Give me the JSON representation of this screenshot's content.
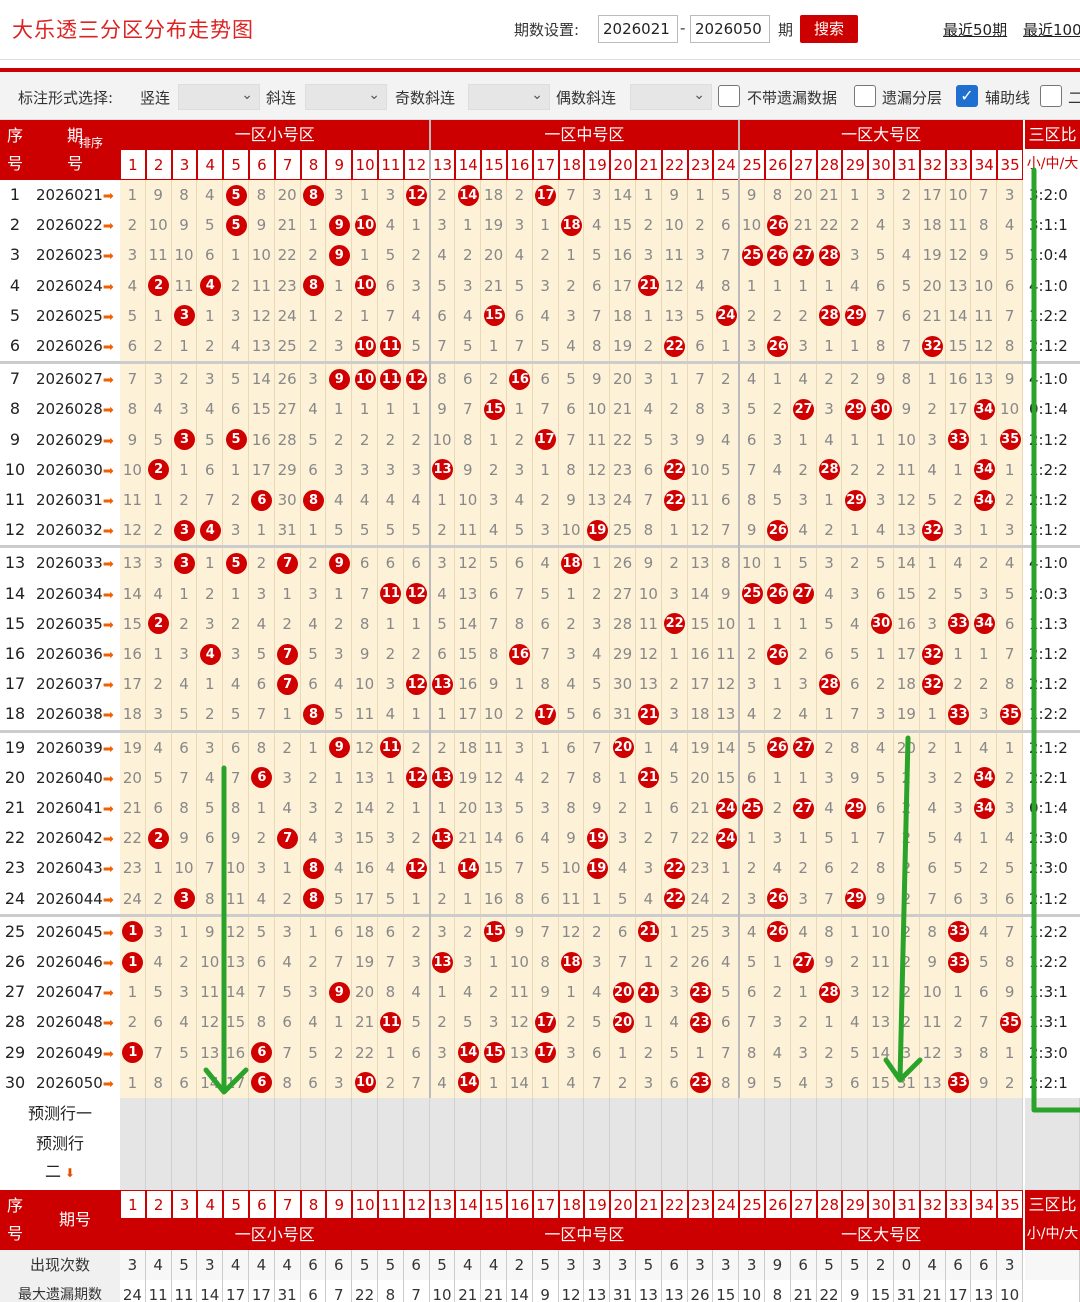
{
  "title": "大乐透三分区分布走势图",
  "period": {
    "label": "期数设置:",
    "start": "2026021",
    "dash": "-",
    "end": "2026050",
    "unit": "期",
    "search": "搜索"
  },
  "links": {
    "recent50": "最近50期",
    "recent100": "最近100"
  },
  "filter": {
    "mark_label": "标注形式选择:",
    "vertical": "竖连",
    "diag": "斜连",
    "odd_diag": "奇数斜连",
    "even_diag": "偶数斜连",
    "no_miss": "不带遗漏数据",
    "miss_layer": "遗漏分层",
    "aux_line": "辅助线",
    "more": "二",
    "checked_aux": true
  },
  "colors": {
    "accent": "#c00000",
    "cell_bg": "#fdf1d8",
    "ball": "#d00000",
    "annotation": "#2aa32a"
  },
  "header": {
    "seq": "序号",
    "issue": "期号",
    "sort": "排序",
    "zone1": "一区小号区",
    "zone2": "一区中号区",
    "zone3": "一区大号区",
    "ratio": "三区比",
    "ratio_sub": "小/中/大",
    "numbers": [
      1,
      2,
      3,
      4,
      5,
      6,
      7,
      8,
      9,
      10,
      11,
      12,
      13,
      14,
      15,
      16,
      17,
      18,
      19,
      20,
      21,
      22,
      23,
      24,
      25,
      26,
      27,
      28,
      29,
      30,
      31,
      32,
      33,
      34,
      35
    ]
  },
  "rows": [
    {
      "seq": 1,
      "issue": "2026021",
      "cells": [
        1,
        9,
        8,
        4,
        "5",
        8,
        20,
        "8",
        3,
        1,
        3,
        "12",
        2,
        "14",
        18,
        2,
        "17",
        7,
        3,
        14,
        1,
        9,
        1,
        5,
        9,
        8,
        20,
        21,
        1,
        3,
        2,
        17,
        10,
        7,
        3
      ],
      "ratio": "3:2:0"
    },
    {
      "seq": 2,
      "issue": "2026022",
      "cells": [
        2,
        10,
        9,
        5,
        "5",
        9,
        21,
        1,
        "9",
        "10",
        4,
        1,
        3,
        1,
        19,
        3,
        1,
        "18",
        4,
        15,
        2,
        10,
        2,
        6,
        10,
        "26",
        21,
        22,
        2,
        4,
        3,
        18,
        11,
        8,
        4
      ],
      "ratio": "3:1:1"
    },
    {
      "seq": 3,
      "issue": "2026023",
      "cells": [
        3,
        11,
        10,
        6,
        1,
        10,
        22,
        2,
        "9",
        1,
        5,
        2,
        4,
        2,
        20,
        4,
        2,
        1,
        5,
        16,
        3,
        11,
        3,
        7,
        "25",
        "26",
        "27",
        "28",
        3,
        5,
        4,
        19,
        12,
        9,
        5
      ],
      "ratio": "1:0:4"
    },
    {
      "seq": 4,
      "issue": "2026024",
      "cells": [
        4,
        "2",
        11,
        "4",
        2,
        11,
        23,
        "8",
        1,
        "10",
        6,
        3,
        5,
        3,
        21,
        5,
        3,
        2,
        6,
        17,
        "21",
        12,
        4,
        8,
        1,
        1,
        1,
        1,
        4,
        6,
        5,
        20,
        13,
        10,
        6
      ],
      "ratio": "4:1:0"
    },
    {
      "seq": 5,
      "issue": "2026025",
      "cells": [
        5,
        1,
        "3",
        1,
        3,
        12,
        24,
        1,
        2,
        1,
        7,
        4,
        6,
        4,
        "15",
        6,
        4,
        3,
        7,
        18,
        1,
        13,
        5,
        "24",
        2,
        2,
        2,
        "28",
        "29",
        7,
        6,
        21,
        14,
        11,
        7
      ],
      "ratio": "1:2:2"
    },
    {
      "seq": 6,
      "issue": "2026026",
      "cells": [
        6,
        2,
        1,
        2,
        4,
        13,
        25,
        2,
        3,
        "10",
        "11",
        5,
        7,
        5,
        1,
        7,
        5,
        4,
        8,
        19,
        2,
        "22",
        6,
        1,
        3,
        "26",
        3,
        1,
        1,
        8,
        7,
        "32",
        15,
        12,
        8
      ],
      "ratio": "2:1:2"
    },
    {
      "seq": 7,
      "issue": "2026027",
      "cells": [
        7,
        3,
        2,
        3,
        5,
        14,
        26,
        3,
        "9",
        "10",
        "11",
        "12",
        8,
        6,
        2,
        "16",
        6,
        5,
        9,
        20,
        3,
        1,
        7,
        2,
        4,
        1,
        4,
        2,
        2,
        9,
        8,
        1,
        16,
        13,
        9
      ],
      "ratio": "4:1:0"
    },
    {
      "seq": 8,
      "issue": "2026028",
      "cells": [
        8,
        4,
        3,
        4,
        6,
        15,
        27,
        4,
        1,
        1,
        1,
        1,
        9,
        7,
        "15",
        1,
        7,
        6,
        10,
        21,
        4,
        2,
        8,
        3,
        5,
        2,
        "27",
        3,
        "29",
        "30",
        9,
        2,
        17,
        "34",
        10
      ],
      "ratio": "0:1:4"
    },
    {
      "seq": 9,
      "issue": "2026029",
      "cells": [
        9,
        5,
        "3",
        5,
        "5",
        16,
        28,
        5,
        2,
        2,
        2,
        2,
        10,
        8,
        1,
        2,
        "17",
        7,
        11,
        22,
        5,
        3,
        9,
        4,
        6,
        3,
        1,
        4,
        1,
        1,
        10,
        3,
        "33",
        1,
        "35"
      ],
      "ratio": "2:1:2"
    },
    {
      "seq": 10,
      "issue": "2026030",
      "cells": [
        10,
        "2",
        1,
        6,
        1,
        17,
        29,
        6,
        3,
        3,
        3,
        3,
        "13",
        9,
        2,
        3,
        1,
        8,
        12,
        23,
        6,
        "22",
        10,
        5,
        7,
        4,
        2,
        "28",
        2,
        2,
        11,
        4,
        1,
        "34",
        1
      ],
      "ratio": "1:2:2"
    },
    {
      "seq": 11,
      "issue": "2026031",
      "cells": [
        11,
        1,
        2,
        7,
        2,
        "6",
        30,
        "8",
        4,
        4,
        4,
        4,
        1,
        10,
        3,
        4,
        2,
        9,
        13,
        24,
        7,
        "22",
        11,
        6,
        8,
        5,
        3,
        1,
        "29",
        3,
        12,
        5,
        2,
        "34",
        2
      ],
      "ratio": "2:1:2"
    },
    {
      "seq": 12,
      "issue": "2026032",
      "cells": [
        12,
        2,
        "3",
        "4",
        3,
        1,
        31,
        1,
        5,
        5,
        5,
        5,
        2,
        11,
        4,
        5,
        3,
        10,
        "19",
        25,
        8,
        1,
        12,
        7,
        9,
        "26",
        4,
        2,
        1,
        4,
        13,
        "32",
        3,
        1,
        3
      ],
      "ratio": "2:1:2"
    },
    {
      "seq": 13,
      "issue": "2026033",
      "cells": [
        13,
        3,
        "3",
        1,
        "5",
        2,
        "7",
        2,
        "9",
        6,
        6,
        6,
        3,
        12,
        5,
        6,
        4,
        "18",
        1,
        26,
        9,
        2,
        13,
        8,
        10,
        1,
        5,
        3,
        2,
        5,
        14,
        1,
        4,
        2,
        4
      ],
      "ratio": "4:1:0"
    },
    {
      "seq": 14,
      "issue": "2026034",
      "cells": [
        14,
        4,
        1,
        2,
        1,
        3,
        1,
        3,
        1,
        7,
        "11",
        "12",
        4,
        13,
        6,
        7,
        5,
        1,
        2,
        27,
        10,
        3,
        14,
        9,
        "25",
        "26",
        "27",
        4,
        3,
        6,
        15,
        2,
        5,
        3,
        5
      ],
      "ratio": "2:0:3"
    },
    {
      "seq": 15,
      "issue": "2026035",
      "cells": [
        15,
        "2",
        2,
        3,
        2,
        4,
        2,
        4,
        2,
        8,
        1,
        1,
        5,
        14,
        7,
        8,
        6,
        2,
        3,
        28,
        11,
        "22",
        15,
        10,
        1,
        1,
        1,
        5,
        4,
        "30",
        16,
        3,
        "33",
        "34",
        6
      ],
      "ratio": "1:1:3"
    },
    {
      "seq": 16,
      "issue": "2026036",
      "cells": [
        16,
        1,
        3,
        "4",
        3,
        5,
        "7",
        5,
        3,
        9,
        2,
        2,
        6,
        15,
        8,
        "16",
        7,
        3,
        4,
        29,
        12,
        1,
        16,
        11,
        2,
        "26",
        2,
        6,
        5,
        1,
        17,
        "32",
        1,
        1,
        7
      ],
      "ratio": "2:1:2"
    },
    {
      "seq": 17,
      "issue": "2026037",
      "cells": [
        17,
        2,
        4,
        1,
        4,
        6,
        "7",
        6,
        4,
        10,
        3,
        "12",
        "13",
        16,
        9,
        1,
        8,
        4,
        5,
        30,
        13,
        2,
        17,
        12,
        3,
        1,
        3,
        "28",
        6,
        2,
        18,
        "32",
        2,
        2,
        8
      ],
      "ratio": "2:1:2"
    },
    {
      "seq": 18,
      "issue": "2026038",
      "cells": [
        18,
        3,
        5,
        2,
        5,
        7,
        1,
        "8",
        5,
        11,
        4,
        1,
        1,
        17,
        10,
        2,
        "17",
        5,
        6,
        31,
        "21",
        3,
        18,
        13,
        4,
        2,
        4,
        1,
        7,
        3,
        19,
        1,
        "33",
        3,
        "35"
      ],
      "ratio": "1:2:2"
    },
    {
      "seq": 19,
      "issue": "2026039",
      "cells": [
        19,
        4,
        6,
        3,
        6,
        8,
        2,
        1,
        "9",
        12,
        "11",
        2,
        2,
        18,
        11,
        3,
        1,
        6,
        7,
        "20",
        1,
        4,
        19,
        14,
        5,
        "26",
        "27",
        2,
        8,
        4,
        20,
        2,
        1,
        4,
        1
      ],
      "ratio": "2:1:2"
    },
    {
      "seq": 20,
      "issue": "2026040",
      "cells": [
        20,
        5,
        7,
        4,
        7,
        "6",
        3,
        2,
        1,
        13,
        1,
        "12",
        "13",
        19,
        12,
        4,
        2,
        7,
        8,
        1,
        "21",
        5,
        20,
        15,
        6,
        1,
        1,
        3,
        9,
        5,
        2,
        3,
        2,
        "34",
        2
      ],
      "ratio": "2:2:1"
    },
    {
      "seq": 21,
      "issue": "2026041",
      "cells": [
        21,
        6,
        8,
        5,
        8,
        1,
        4,
        3,
        2,
        14,
        2,
        1,
        1,
        20,
        13,
        5,
        3,
        8,
        9,
        2,
        1,
        6,
        21,
        "24",
        "25",
        2,
        "27",
        4,
        "29",
        6,
        2,
        4,
        3,
        "34",
        3
      ],
      "ratio": "0:1:4"
    },
    {
      "seq": 22,
      "issue": "2026042",
      "cells": [
        22,
        "2",
        9,
        6,
        9,
        2,
        "7",
        4,
        3,
        15,
        3,
        2,
        "13",
        21,
        14,
        6,
        4,
        9,
        "19",
        3,
        2,
        7,
        22,
        "24",
        1,
        3,
        1,
        5,
        1,
        7,
        2,
        5,
        4,
        1,
        4
      ],
      "ratio": "2:3:0"
    },
    {
      "seq": 23,
      "issue": "2026043",
      "cells": [
        23,
        1,
        10,
        7,
        10,
        3,
        1,
        "8",
        4,
        16,
        4,
        "12",
        1,
        "14",
        15,
        7,
        5,
        10,
        "19",
        4,
        3,
        "22",
        23,
        1,
        2,
        4,
        2,
        6,
        2,
        8,
        2,
        6,
        5,
        2,
        5
      ],
      "ratio": "2:3:0"
    },
    {
      "seq": 24,
      "issue": "2026044",
      "cells": [
        24,
        2,
        "3",
        8,
        11,
        4,
        2,
        "8",
        5,
        17,
        5,
        1,
        2,
        1,
        16,
        8,
        6,
        11,
        1,
        5,
        4,
        "22",
        24,
        2,
        3,
        "26",
        3,
        7,
        "29",
        9,
        2,
        7,
        6,
        3,
        6
      ],
      "ratio": "2:1:2"
    },
    {
      "seq": 25,
      "issue": "2026045",
      "cells": [
        "1",
        3,
        1,
        9,
        12,
        5,
        3,
        1,
        6,
        18,
        6,
        2,
        3,
        2,
        "15",
        9,
        7,
        12,
        2,
        6,
        "21",
        1,
        25,
        3,
        4,
        "26",
        4,
        8,
        1,
        10,
        2,
        8,
        "33",
        4,
        7
      ],
      "ratio": "1:2:2"
    },
    {
      "seq": 26,
      "issue": "2026046",
      "cells": [
        "1",
        4,
        2,
        10,
        13,
        6,
        4,
        2,
        7,
        19,
        7,
        3,
        "13",
        3,
        1,
        10,
        8,
        "18",
        3,
        7,
        1,
        2,
        26,
        4,
        5,
        1,
        "27",
        9,
        2,
        11,
        2,
        9,
        "33",
        5,
        8
      ],
      "ratio": "1:2:2"
    },
    {
      "seq": 27,
      "issue": "2026047",
      "cells": [
        1,
        5,
        3,
        11,
        14,
        7,
        5,
        3,
        "9",
        20,
        8,
        4,
        1,
        4,
        2,
        11,
        9,
        1,
        4,
        "20",
        "21",
        3,
        "23",
        5,
        6,
        2,
        1,
        "28",
        3,
        12,
        2,
        10,
        1,
        6,
        9
      ],
      "ratio": "1:3:1"
    },
    {
      "seq": 28,
      "issue": "2026048",
      "cells": [
        2,
        6,
        4,
        12,
        15,
        8,
        6,
        4,
        1,
        21,
        "11",
        5,
        2,
        5,
        3,
        12,
        "17",
        2,
        5,
        "20",
        1,
        4,
        "23",
        6,
        7,
        3,
        2,
        1,
        4,
        13,
        2,
        11,
        2,
        7,
        "35"
      ],
      "ratio": "1:3:1"
    },
    {
      "seq": 29,
      "issue": "2026049",
      "cells": [
        "1",
        7,
        5,
        13,
        16,
        "6",
        7,
        5,
        2,
        22,
        1,
        6,
        3,
        "14",
        "15",
        13,
        "17",
        3,
        6,
        1,
        2,
        5,
        1,
        7,
        8,
        4,
        3,
        2,
        5,
        14,
        3,
        12,
        3,
        8,
        1
      ],
      "ratio": "2:3:0"
    },
    {
      "seq": 30,
      "issue": "2026050",
      "cells": [
        1,
        8,
        6,
        14,
        17,
        "6",
        8,
        6,
        3,
        "10",
        2,
        7,
        4,
        "14",
        1,
        14,
        1,
        4,
        7,
        2,
        3,
        6,
        "23",
        8,
        9,
        5,
        4,
        3,
        6,
        15,
        31,
        13,
        "33",
        9,
        2
      ],
      "ratio": "2:2:1"
    }
  ],
  "predict": {
    "row1": "预测行一",
    "row2": "预测行",
    "row2b": "二"
  },
  "summary": {
    "count_label": "出现次数",
    "counts": [
      3,
      4,
      5,
      3,
      4,
      4,
      4,
      6,
      6,
      5,
      5,
      6,
      5,
      4,
      4,
      2,
      5,
      3,
      3,
      3,
      5,
      6,
      3,
      3,
      3,
      9,
      6,
      5,
      5,
      2,
      0,
      4,
      6,
      6,
      3
    ],
    "maxmiss_label": "最大遗漏期数",
    "maxmiss": [
      24,
      11,
      11,
      14,
      17,
      17,
      31,
      6,
      7,
      22,
      8,
      7,
      10,
      21,
      21,
      14,
      9,
      12,
      13,
      31,
      13,
      13,
      26,
      15,
      10,
      8,
      21,
      22,
      9,
      15,
      31,
      21,
      17,
      13,
      10
    ]
  }
}
